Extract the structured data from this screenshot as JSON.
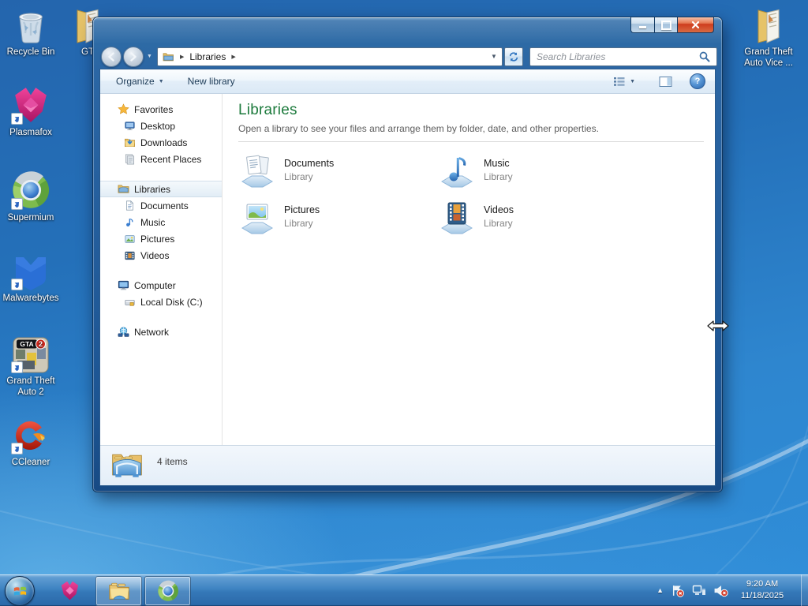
{
  "colors": {
    "accent_green": "#1c7a3c",
    "glass_blue": "#2d6aa5",
    "taskbar_blue": "#3f84c2",
    "selection_highlight": "#e2edf6",
    "close_button_red": "#ce3c1e"
  },
  "icons": {
    "breadcrumb_arrow": "▶",
    "caret_down": "▼",
    "hidden_icons_arrow": "▲",
    "help_glyph": "?"
  },
  "desktop": {
    "icons": [
      {
        "label": "Recycle Bin"
      },
      {
        "label": "GT"
      },
      {
        "label": "Plasmafox"
      },
      {
        "label": "Supermium"
      },
      {
        "label": "Malwarebytes"
      },
      {
        "label": "Grand Theft Auto 2"
      },
      {
        "label": "CCleaner"
      },
      {
        "label": "Grand Theft Auto Vice ..."
      }
    ]
  },
  "window": {
    "navbar": {
      "breadcrumb": "Libraries",
      "search_placeholder": "Search Libraries"
    },
    "toolbar": {
      "organize_label": "Organize",
      "new_library_label": "New library"
    },
    "sidebar": {
      "favorites": {
        "label": "Favorites",
        "items": [
          {
            "label": "Desktop"
          },
          {
            "label": "Downloads"
          },
          {
            "label": "Recent Places"
          }
        ]
      },
      "libraries": {
        "label": "Libraries",
        "items": [
          {
            "label": "Documents"
          },
          {
            "label": "Music"
          },
          {
            "label": "Pictures"
          },
          {
            "label": "Videos"
          }
        ]
      },
      "computer": {
        "label": "Computer",
        "items": [
          {
            "label": "Local Disk (C:)"
          }
        ]
      },
      "network": {
        "label": "Network"
      }
    },
    "main": {
      "title": "Libraries",
      "subtitle": "Open a library to see your files and arrange them by folder, date, and other properties.",
      "items": [
        {
          "name": "Documents",
          "kind": "Library"
        },
        {
          "name": "Music",
          "kind": "Library"
        },
        {
          "name": "Pictures",
          "kind": "Library"
        },
        {
          "name": "Videos",
          "kind": "Library"
        }
      ]
    },
    "statusbar": {
      "item_count": "4 items"
    }
  },
  "taskbar": {
    "clock": {
      "time": "9:20 AM",
      "date": "11/18/2025"
    }
  }
}
